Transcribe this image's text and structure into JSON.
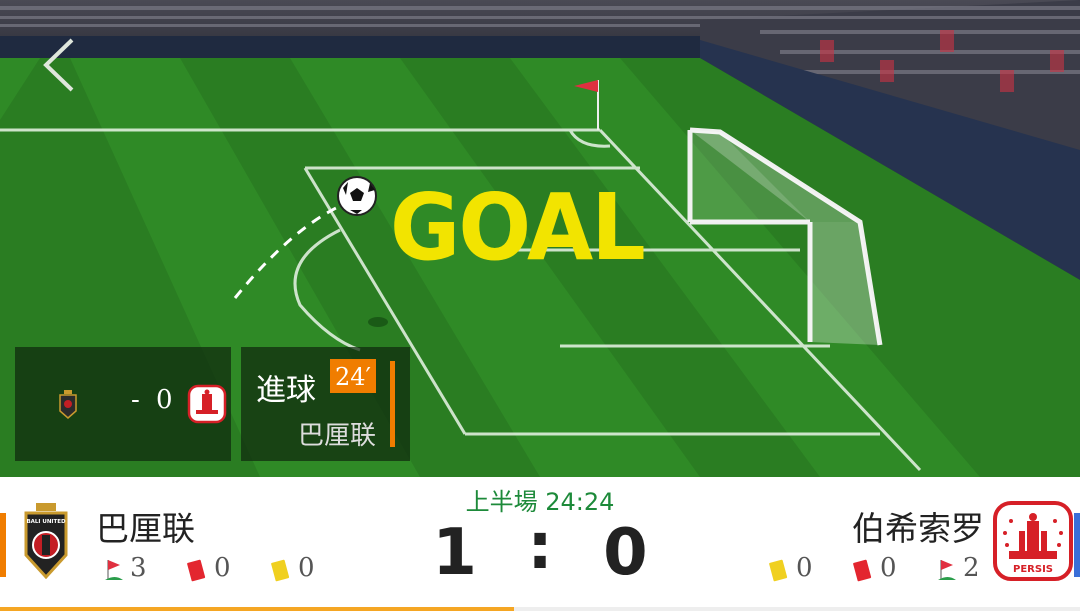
{
  "overlay": {
    "goal_text": "GOAL",
    "mini_score": {
      "dash": "-",
      "score": "0"
    },
    "event": {
      "title": "進球",
      "minute": "24′",
      "team": "巴厘联"
    }
  },
  "match": {
    "period": "上半場",
    "clock": "24:24",
    "home": {
      "name": "巴厘联",
      "score": "1",
      "corners": "3",
      "red_cards": "0",
      "yellow_cards": "0",
      "logo_text": "BALI UNITED"
    },
    "away": {
      "name": "伯希索罗",
      "score": "0",
      "corners": "2",
      "red_cards": "0",
      "yellow_cards": "0",
      "logo_text": "PERSIS"
    },
    "separator": ":",
    "progress": 0.476
  },
  "colors": {
    "accent": "#f07d00",
    "goal_yellow": "#f2e400",
    "period_green": "#1d8a3a",
    "away_bar": "#3a6fd8"
  }
}
